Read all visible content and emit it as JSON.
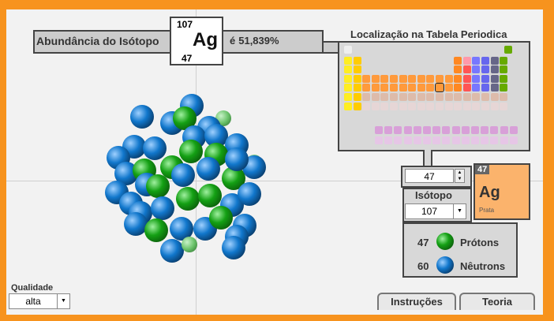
{
  "abundance": {
    "label": "Abundância do Isótopo",
    "mass_number": "107",
    "symbol": "Ag",
    "atomic_number": "47",
    "prefix": "é",
    "value": "51,839%"
  },
  "periodic_table": {
    "title": "Localização na Tabela Periodica",
    "selected": "Ag"
  },
  "stepper": {
    "value": "47"
  },
  "element_card": {
    "atomic_number": "47",
    "symbol": "Ag",
    "name": "Prata"
  },
  "isotope": {
    "label": "Isótopo",
    "selected": "107"
  },
  "legend": {
    "protons": {
      "count": "47",
      "label": "Prótons"
    },
    "neutrons": {
      "count": "60",
      "label": "Nêutrons"
    }
  },
  "quality": {
    "label": "Qualidade",
    "selected": "alta"
  },
  "tabs": {
    "instructions": "Instruções",
    "theory": "Teoria"
  },
  "colors": {
    "background": "#f7931e",
    "panel": "#f2f2f2",
    "proton": "#14a014",
    "neutron": "#1177cc",
    "card": "#fbb36c"
  }
}
